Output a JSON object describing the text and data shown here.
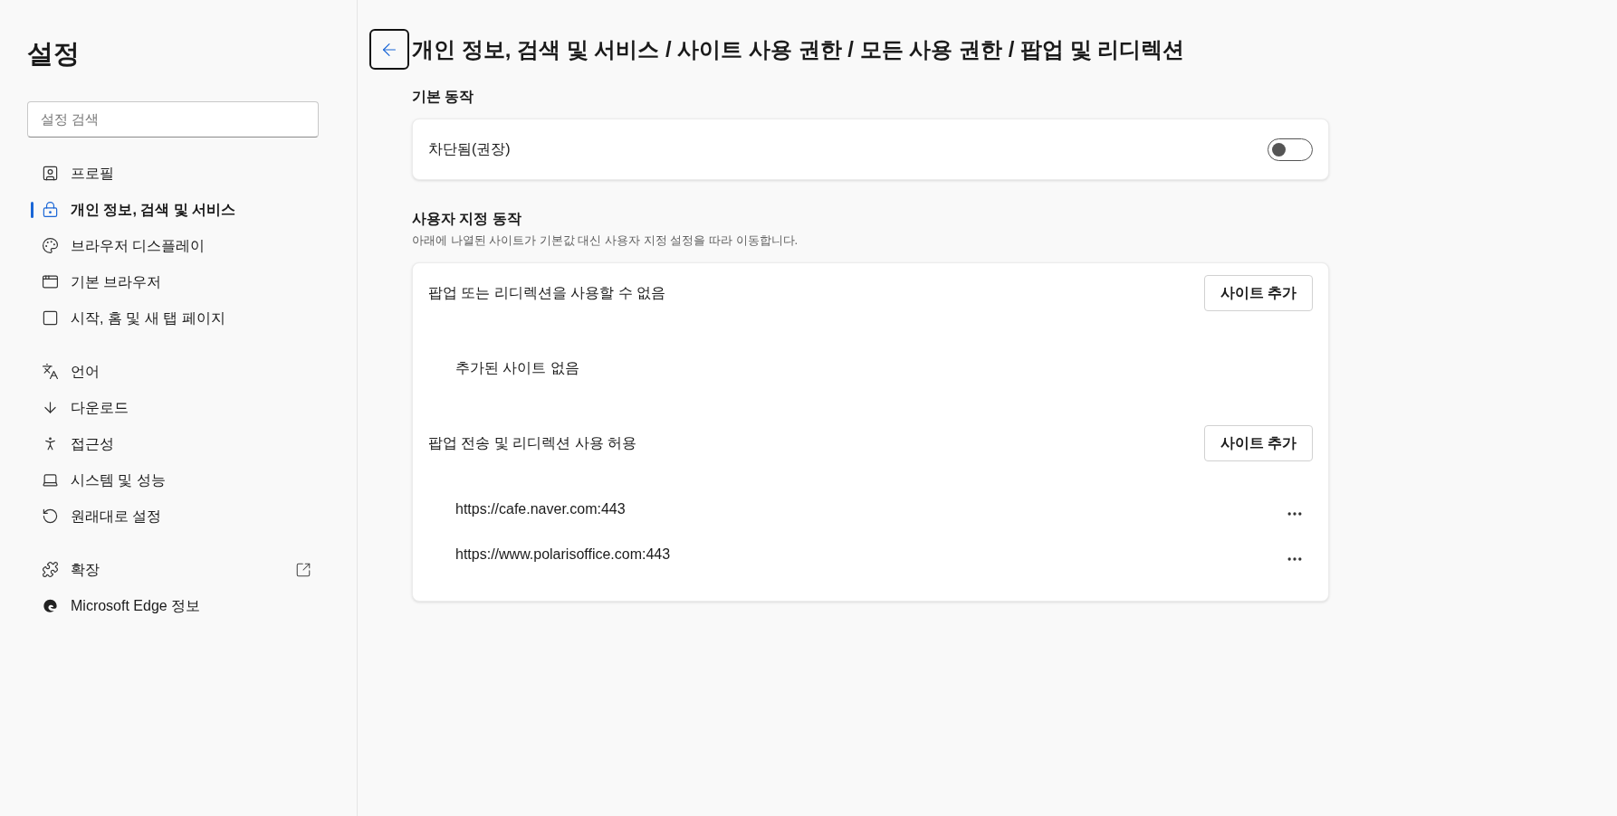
{
  "sidebar": {
    "title": "설정",
    "search": {
      "placeholder": "설정 검색"
    },
    "groups": [
      [
        {
          "label": "프로필",
          "selected": false
        },
        {
          "label": "개인 정보, 검색 및 서비스",
          "selected": true
        },
        {
          "label": "브라우저 디스플레이",
          "selected": false
        },
        {
          "label": "기본 브라우저",
          "selected": false
        },
        {
          "label": "시작, 홈 및 새 탭 페이지",
          "selected": false
        }
      ],
      [
        {
          "label": "언어",
          "selected": false
        },
        {
          "label": "다운로드",
          "selected": false
        },
        {
          "label": "접근성",
          "selected": false
        },
        {
          "label": "시스템 및 성능",
          "selected": false
        },
        {
          "label": "원래대로 설정",
          "selected": false
        }
      ],
      [
        {
          "label": "확장",
          "selected": false,
          "external": true
        },
        {
          "label": "Microsoft Edge 정보",
          "selected": false,
          "external": false
        }
      ]
    ]
  },
  "header": {
    "breadcrumb": "개인 정보, 검색 및 서비스 / 사이트 사용 권한 / 모든 사용 권한 / 팝업 및 리디렉션"
  },
  "default_behavior": {
    "heading": "기본 동작",
    "toggle": {
      "label": "차단됨(권장)",
      "on": false
    }
  },
  "custom_behavior": {
    "heading": "사용자 지정 동작",
    "description": "아래에 나열된 사이트가 기본값 대신 사용자 지정 설정을 따라 이동합니다.",
    "lists": [
      {
        "title": "팝업 또는 리디렉션을 사용할 수 없음",
        "button": "사이트 추가",
        "empty_text": "추가된 사이트 없음"
      },
      {
        "title": "팝업 전송 및 리디렉션 사용 허용",
        "button": "사이트 추가",
        "sites": [
          "https://cafe.naver.com:443",
          "https://www.polarisoffice.com:443"
        ]
      }
    ]
  }
}
